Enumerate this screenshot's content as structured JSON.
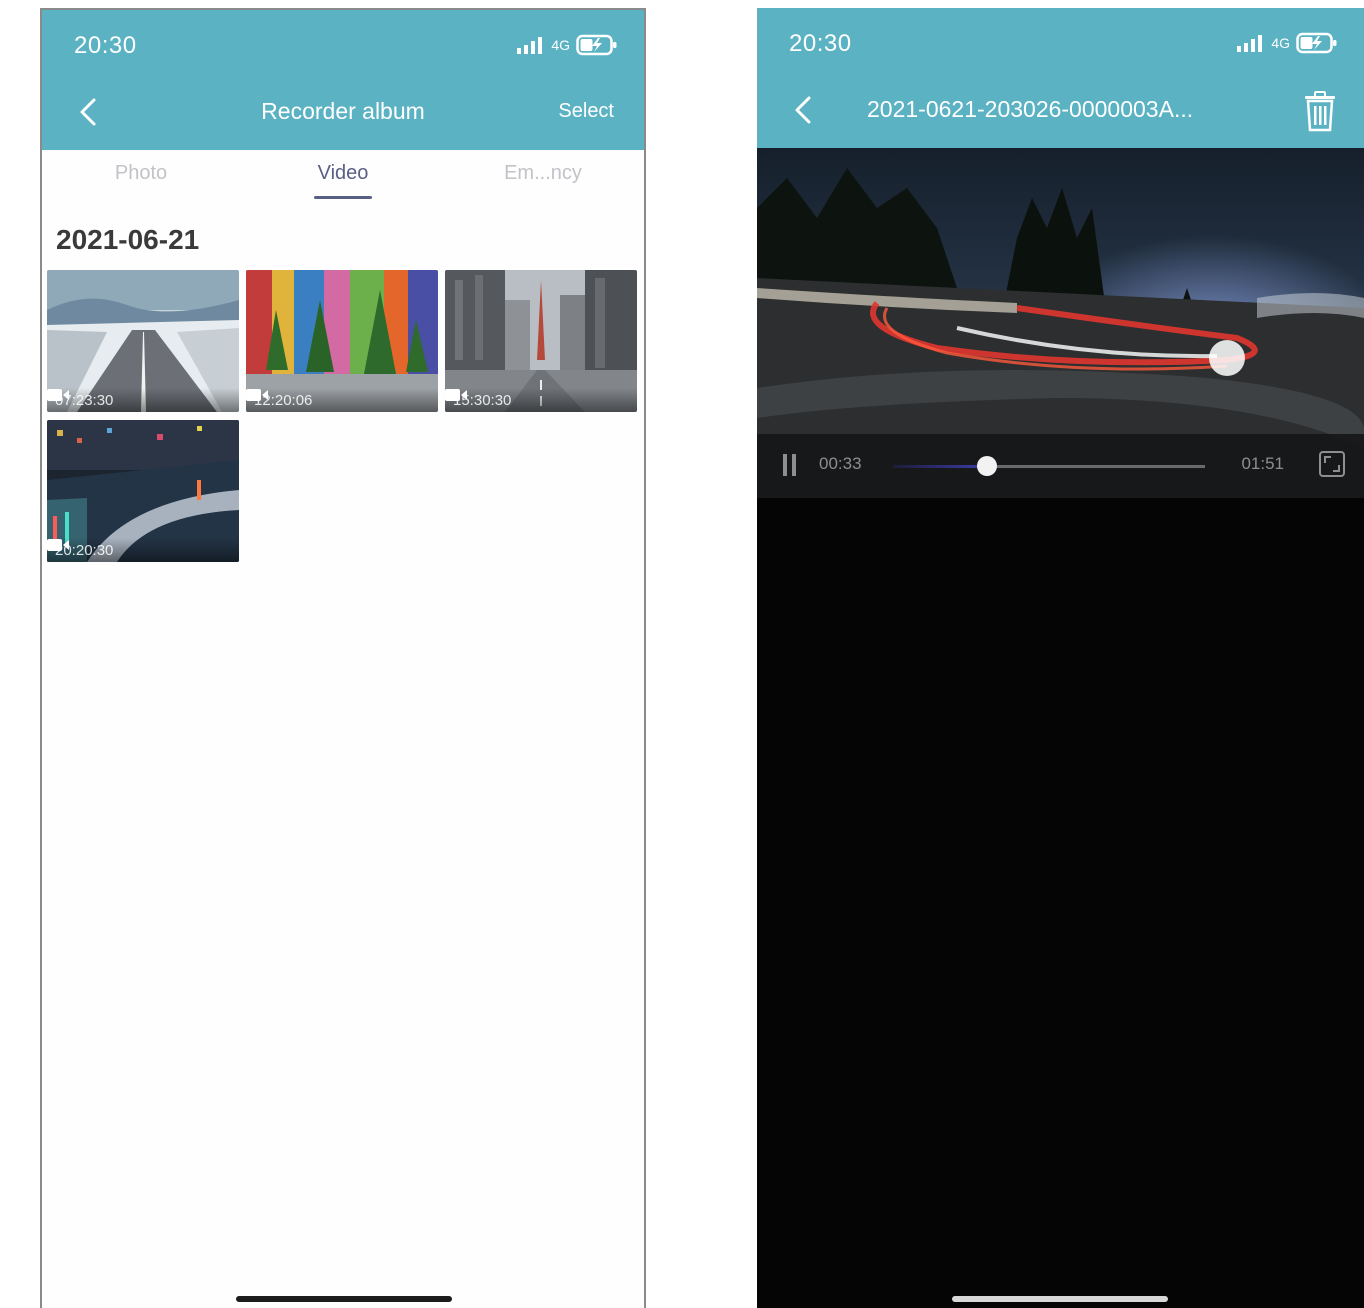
{
  "left_screen": {
    "status_time": "20:30",
    "network": "4G",
    "title": "Recorder album",
    "select_label": "Select",
    "tabs": [
      {
        "label": "Photo",
        "active": false
      },
      {
        "label": "Video",
        "active": true
      },
      {
        "label": "Em...ncy",
        "active": false
      }
    ],
    "date_header": "2021-06-21",
    "videos": [
      {
        "time": "07:23:30",
        "scene": "snowy-road"
      },
      {
        "time": "12:20:06",
        "scene": "colorful-street"
      },
      {
        "time": "15:30:30",
        "scene": "city-avenue"
      },
      {
        "time": "20:20:30",
        "scene": "night-city"
      }
    ]
  },
  "right_screen": {
    "status_time": "20:30",
    "network": "4G",
    "title": "2021-0621-203026-0000003A...",
    "player": {
      "current_time": "00:33",
      "total_time": "01:51",
      "progress": 0.3
    }
  },
  "colors": {
    "header": "#5ab2c3",
    "active_tab": "#5a5f86",
    "inactive_tab": "#c2c2c8",
    "player_bg": "#050505"
  }
}
